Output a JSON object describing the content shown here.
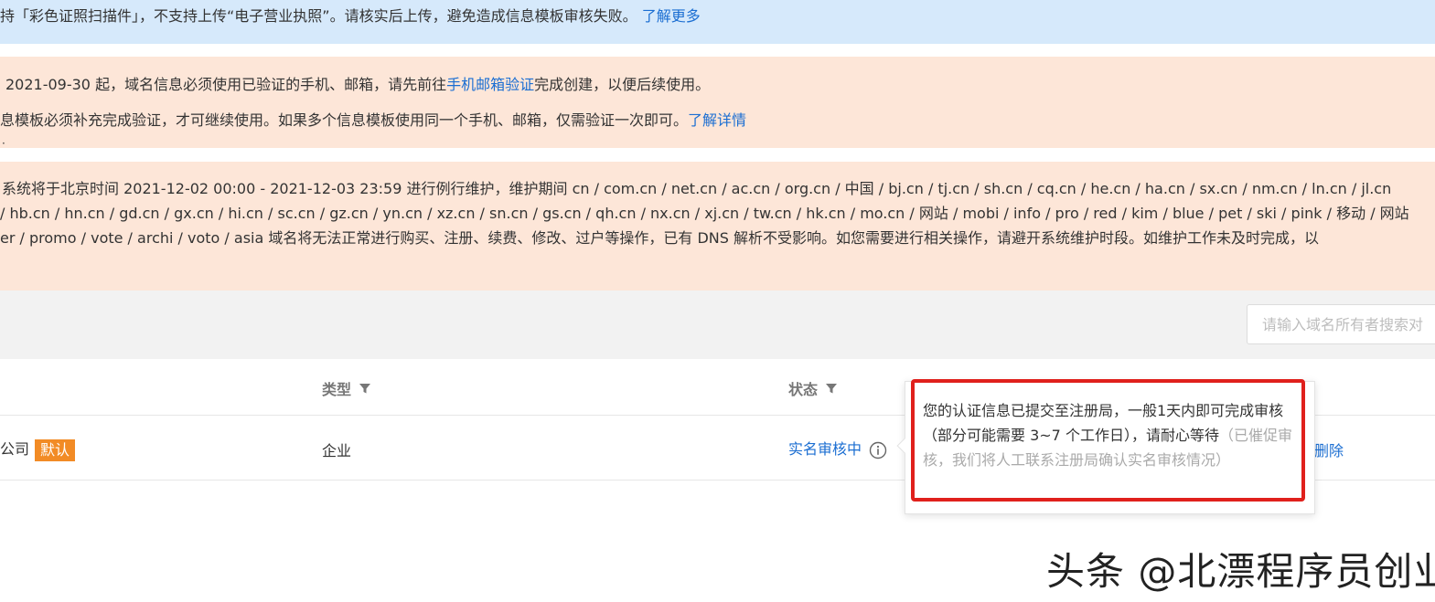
{
  "notices": {
    "blue_text": "持「彩色证照扫描件」，不支持上传“电子营业执照”。请核实后上传，避免造成信息模板审核失败。",
    "blue_link": "了解更多",
    "orange1_line1_prefix": "2021-09-30 起，域名信息必须使用已验证的手机、邮箱，请先前往",
    "orange1_line1_link": "手机邮箱验证",
    "orange1_line1_suffix": "完成创建，以便后续使用。",
    "orange1_line2_text": "息模板必须补充完成验证，才可继续使用。如果多个信息模板使用同一个手机、邮箱，仅需验证一次即可。",
    "orange1_line2_link": "了解详情",
    "orange2_line1": "系统将于北京时间 2021-12-02 00:00 - 2021-12-03 23:59 进行例行维护，维护期间 cn / com.cn / net.cn / ac.cn / org.cn / 中国 / bj.cn / tj.cn / sh.cn / cq.cn / he.cn / ha.cn / sx.cn / nm.cn / ln.cn / jl.cn",
    "orange2_line2": "/ hb.cn / hn.cn / gd.cn / gx.cn / hi.cn / sc.cn / gz.cn / yn.cn / xz.cn / sn.cn / gs.cn / qh.cn / nx.cn / xj.cn / tw.cn / hk.cn / mo.cn / 网站 / mobi / info / pro / red / kim / blue / pet / ski / pink / 移动 / 网站",
    "orange2_line3": "er / promo / vote / archi / voto / asia 域名将无法正常进行购买、注册、续费、修改、过户等操作，已有 DNS 解析不受影响。如您需要进行相关操作，请避开系统维护时段。如维护工作未及时完成，以"
  },
  "search": {
    "placeholder": "请输入域名所有者搜索对"
  },
  "table": {
    "headers": {
      "type": "类型",
      "status": "状态"
    },
    "row": {
      "owner_suffix": "公司",
      "default_badge": "默认",
      "type": "企业",
      "status": "实名审核中",
      "action_delete": "删除"
    }
  },
  "popover": {
    "main_text": "您的认证信息已提交至注册局，一般1天内即可完成审核（部分可能需要 3~7 个工作日），请耐心等待",
    "muted_text": "（已催促审核，我们将人工联系注册局确认实名审核情况）"
  },
  "watermark": "头条 @北漂程序员创业",
  "colors": {
    "link": "#1b6ed2",
    "badge": "#f28b25",
    "highlight": "#e0201c",
    "notice_blue": "#d6e9fb",
    "notice_orange": "#fde6d8"
  }
}
